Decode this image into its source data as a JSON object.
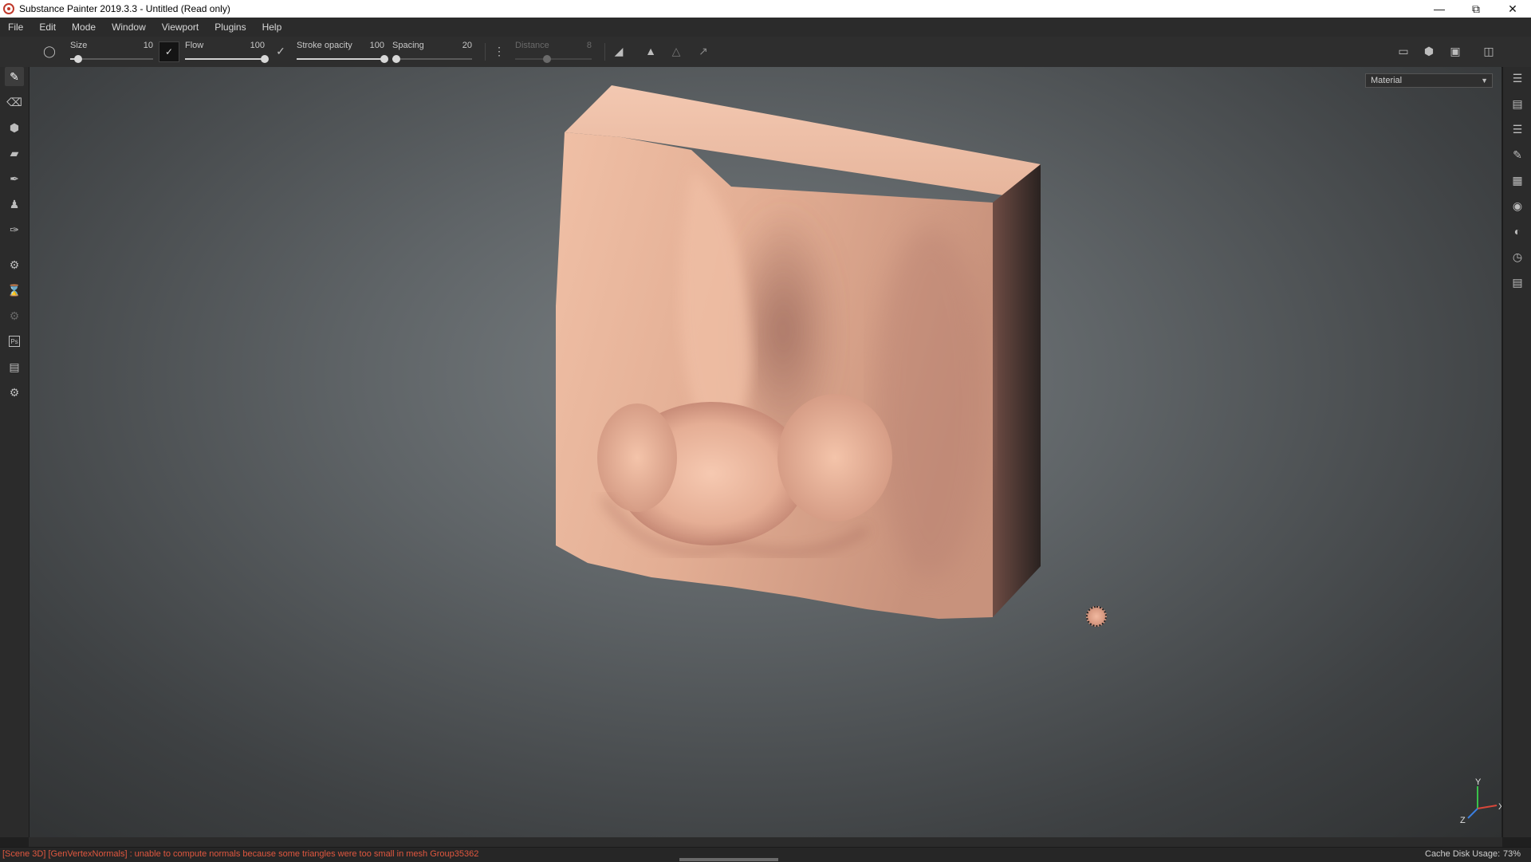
{
  "window": {
    "title": "Substance Painter 2019.3.3 - Untitled (Read only)",
    "controls": [
      "minimize",
      "restore",
      "close"
    ]
  },
  "menu": [
    "File",
    "Edit",
    "Mode",
    "Window",
    "Viewport",
    "Plugins",
    "Help"
  ],
  "toolbar": {
    "size": {
      "label": "Size",
      "value": "10",
      "fraction": 0.1
    },
    "flow": {
      "label": "Flow",
      "value": "100",
      "fraction": 1.0
    },
    "stroke_opacity": {
      "label": "Stroke opacity",
      "value": "100",
      "fraction": 1.0
    },
    "spacing": {
      "label": "Spacing",
      "value": "20",
      "fraction": 0.05
    },
    "distance": {
      "label": "Distance",
      "value": "8",
      "fraction": 0.42,
      "disabled": true
    }
  },
  "viewport": {
    "channel": "Material"
  },
  "gizmo": {
    "y": "Y",
    "x": "X",
    "z": "Z"
  },
  "status": {
    "message": "[Scene 3D] [GenVertexNormals] : unable to compute normals because some triangles were too small in mesh Group35362",
    "cache_label": "Cache Disk Usage:",
    "cache_value": "73%"
  },
  "colors": {
    "error_text": "#e0573f",
    "skin": "#e6b59c",
    "accent": "#c0392b"
  }
}
